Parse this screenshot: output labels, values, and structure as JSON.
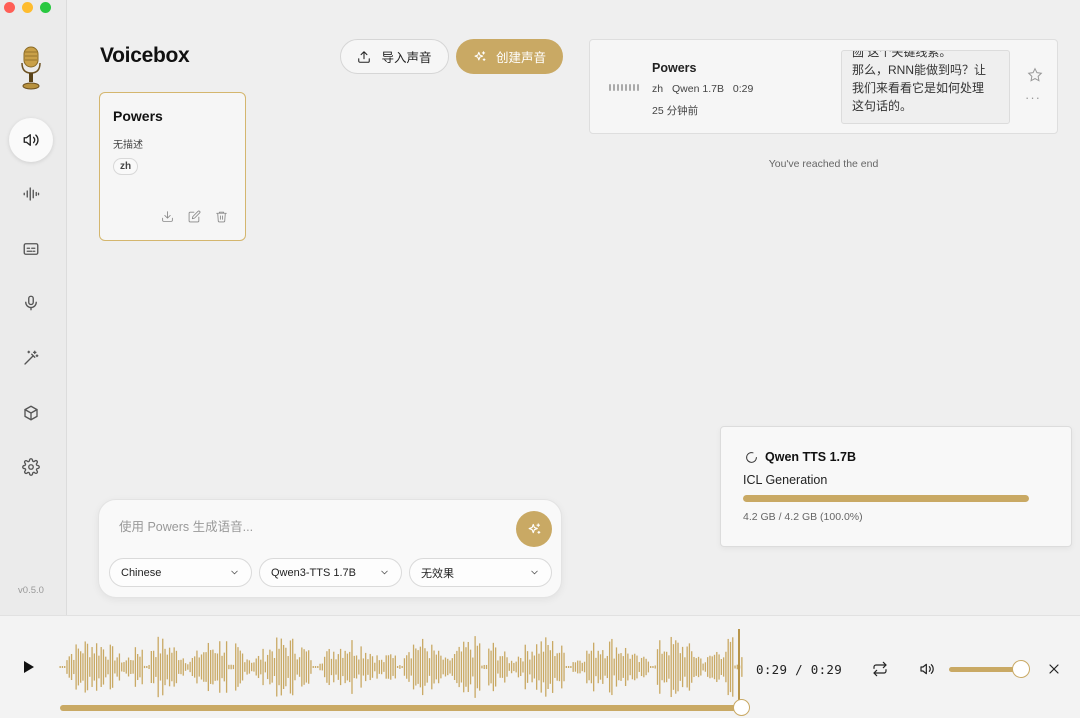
{
  "window": {
    "controls": [
      "close",
      "minimize",
      "maximize"
    ]
  },
  "sidebar": {
    "logo": "microphone-logo",
    "items": [
      {
        "id": "voices",
        "icon": "speaker-icon",
        "active": true
      },
      {
        "id": "generate",
        "icon": "audio-waveform-icon",
        "active": false
      },
      {
        "id": "stories",
        "icon": "caption-icon",
        "active": false
      },
      {
        "id": "record",
        "icon": "microphone-icon",
        "active": false
      },
      {
        "id": "effects",
        "icon": "magic-wand-icon",
        "active": false
      },
      {
        "id": "models",
        "icon": "cube-icon",
        "active": false
      },
      {
        "id": "settings",
        "icon": "gear-icon",
        "active": false
      }
    ],
    "version": "v0.5.0"
  },
  "header": {
    "title": "Voicebox",
    "import_label": "导入声音",
    "create_label": "创建声音"
  },
  "voice_card": {
    "name": "Powers",
    "description": "无描述",
    "language": "zh",
    "actions": [
      "download-icon",
      "edit-icon",
      "trash-icon"
    ]
  },
  "history": {
    "item": {
      "name": "Powers",
      "language": "zh",
      "model": "Qwen 1.7B",
      "duration": "0:29",
      "time_ago": "25 分钟前",
      "text_lines": [
        "囫 这个关键线索。",
        "那么，RNN能做到吗？让",
        "我们来看看它是如何处理",
        "这句话的。"
      ]
    },
    "end_text": "You've reached the end"
  },
  "generate": {
    "placeholder": "使用 Powers 生成语音...",
    "language": "Chinese",
    "model": "Qwen3-TTS 1.7B",
    "effect": "无效果"
  },
  "download": {
    "title": "Qwen TTS 1.7B",
    "subtitle": "ICL Generation",
    "size_text": "4.2 GB / 4.2 GB (100.0%)",
    "progress": 1.0
  },
  "player": {
    "time": "0:29 / 0:29",
    "progress": 1.0,
    "volume": 0.9
  },
  "colors": {
    "accent": "#c9a964",
    "background": "#efefef",
    "sidebar": "#ebebeb"
  }
}
